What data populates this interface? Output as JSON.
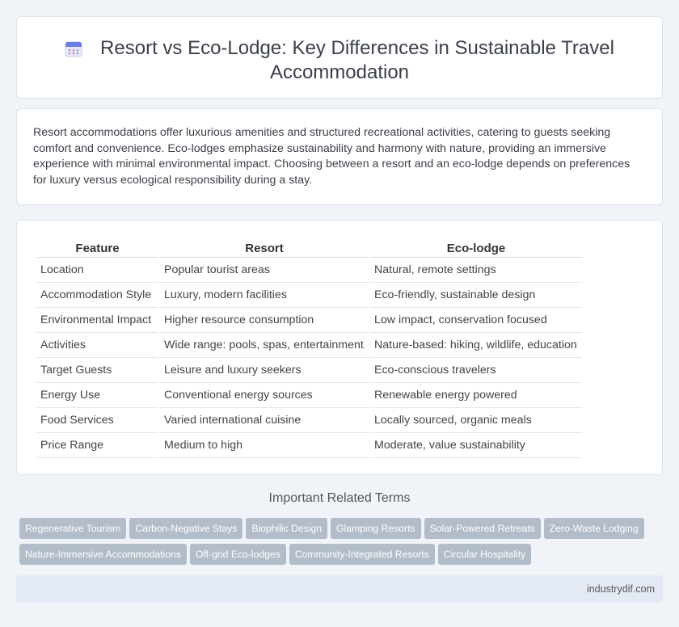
{
  "header": {
    "icon": "calendar-icon",
    "title": "Resort vs Eco-Lodge: Key Differences in Sustainable Travel Accommodation"
  },
  "intro": {
    "text": "Resort accommodations offer luxurious amenities and structured recreational activities, catering to guests seeking comfort and convenience. Eco-lodges emphasize sustainability and harmony with nature, providing an immersive experience with minimal environmental impact. Choosing between a resort and an eco-lodge depends on preferences for luxury versus ecological responsibility during a stay."
  },
  "table": {
    "headers": [
      "Feature",
      "Resort",
      "Eco-lodge"
    ],
    "rows": [
      [
        "Location",
        "Popular tourist areas",
        "Natural, remote settings"
      ],
      [
        "Accommodation Style",
        "Luxury, modern facilities",
        "Eco-friendly, sustainable design"
      ],
      [
        "Environmental Impact",
        "Higher resource consumption",
        "Low impact, conservation focused"
      ],
      [
        "Activities",
        "Wide range: pools, spas, entertainment",
        "Nature-based: hiking, wildlife, education"
      ],
      [
        "Target Guests",
        "Leisure and luxury seekers",
        "Eco-conscious travelers"
      ],
      [
        "Energy Use",
        "Conventional energy sources",
        "Renewable energy powered"
      ],
      [
        "Food Services",
        "Varied international cuisine",
        "Locally sourced, organic meals"
      ],
      [
        "Price Range",
        "Medium to high",
        "Moderate, value sustainability"
      ]
    ]
  },
  "related": {
    "title": "Important Related Terms",
    "tags": [
      "Regenerative Tourism",
      "Carbon-Negative Stays",
      "Biophilic Design",
      "Glamping Resorts",
      "Solar-Powered Retreats",
      "Zero-Waste Lodging",
      "Nature-Immersive Accommodations",
      "Off-grid Eco-lodges",
      "Community-Integrated Resorts",
      "Circular Hospitality"
    ]
  },
  "footer": {
    "site": "industrydif.com"
  },
  "colors": {
    "background": "#f0f3f8",
    "tag": "#b3bcc9",
    "footer": "#e4eaf4"
  }
}
